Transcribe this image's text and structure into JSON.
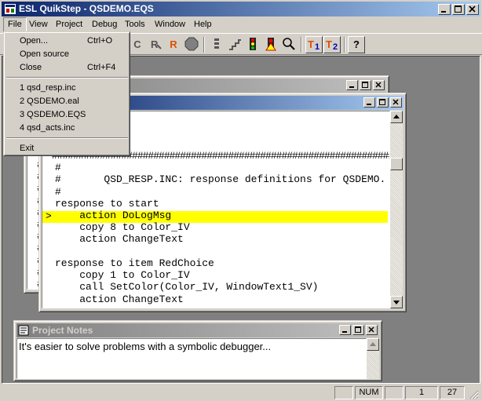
{
  "app": {
    "title": "ESL QuikStep - QSDEMO.EQS"
  },
  "menubar": [
    "File",
    "View",
    "Project",
    "Debug",
    "Tools",
    "Window",
    "Help"
  ],
  "file_menu": {
    "items": [
      {
        "label": "Open...",
        "shortcut": "Ctrl+O"
      },
      {
        "label": "Open source",
        "shortcut": ""
      },
      {
        "label": "Close",
        "shortcut": "Ctrl+F4"
      }
    ],
    "recent": [
      "1 qsd_resp.inc",
      "2 QSDEMO.eal",
      "3 QSDEMO.EQS",
      "4 qsd_acts.inc"
    ],
    "exit": "Exit"
  },
  "toolbar": {
    "buttons": [
      "C",
      "R",
      "R",
      "T1",
      "T2",
      "?"
    ]
  },
  "code_window": {
    "lines": [
      "#",
      "#       QSD_RESP.INC: response definitions for QSDEMO.",
      "#",
      "response to start",
      "    action DoLogMsg",
      "    copy 8 to Color_IV",
      "    action ChangeText",
      "",
      "response to item RedChoice",
      "    copy 1 to Color_IV",
      "    call SetColor(Color_IV, WindowText1_SV)",
      "    action ChangeText"
    ],
    "current_line_marker": ">",
    "hash_row": "################################################################"
  },
  "notes_window": {
    "title": "Project Notes",
    "text": "It's easier to solve problems with a symbolic debugger..."
  },
  "statusbar": {
    "num": "NUM",
    "line": "1",
    "col": "27"
  },
  "colors": {
    "titlebar": "#0a246a",
    "highlight": "#ffff00",
    "face": "#d4d0c8"
  }
}
